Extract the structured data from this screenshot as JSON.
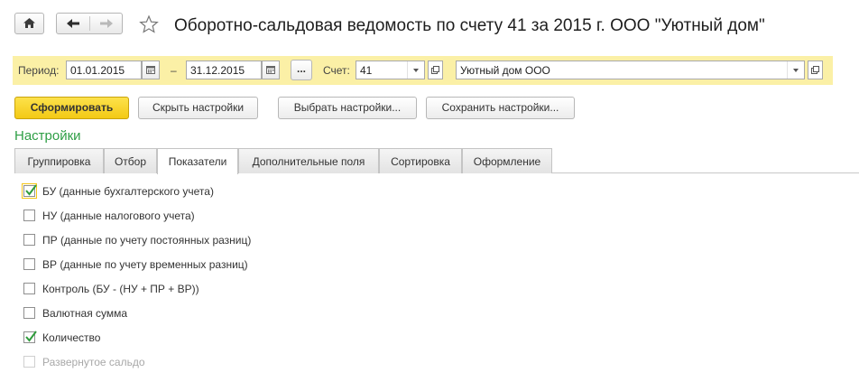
{
  "window": {
    "title": "Оборотно-сальдовая ведомость по счету 41 за 2015 г. ООО \"Уютный дом\""
  },
  "period": {
    "label": "Период:",
    "from": "01.01.2015",
    "dash": "–",
    "to": "31.12.2015",
    "choose_label": "...",
    "account_label": "Счет:",
    "account_value": "41",
    "organization_value": "Уютный дом ООО"
  },
  "commands": {
    "generate": "Сформировать",
    "hide_settings": "Скрыть настройки",
    "choose_settings": "Выбрать настройки...",
    "save_settings": "Сохранить настройки..."
  },
  "settings_title": "Настройки",
  "tabs": [
    {
      "label": "Группировка",
      "active": false
    },
    {
      "label": "Отбор",
      "active": false
    },
    {
      "label": "Показатели",
      "active": true
    },
    {
      "label": "Дополнительные поля",
      "active": false
    },
    {
      "label": "Сортировка",
      "active": false
    },
    {
      "label": "Оформление",
      "active": false
    }
  ],
  "indicators": [
    {
      "label": "БУ (данные бухгалтерского учета)",
      "checked": true,
      "disabled": false
    },
    {
      "label": "НУ (данные налогового учета)",
      "checked": false,
      "disabled": false
    },
    {
      "label": "ПР (данные по учету постоянных разниц)",
      "checked": false,
      "disabled": false
    },
    {
      "label": "ВР (данные по учету временных разниц)",
      "checked": false,
      "disabled": false
    },
    {
      "label": "Контроль (БУ - (НУ + ПР + ВР))",
      "checked": false,
      "disabled": false
    },
    {
      "label": "Валютная сумма",
      "checked": false,
      "disabled": false
    },
    {
      "label": "Количество",
      "checked": true,
      "disabled": false
    },
    {
      "label": "Развернутое сальдо",
      "checked": false,
      "disabled": true
    }
  ],
  "colors": {
    "accent_green": "#2e9e45",
    "panel_yellow": "#fbf0a6",
    "primary_button": "#f3c915",
    "check_green": "#2f9c3c"
  }
}
